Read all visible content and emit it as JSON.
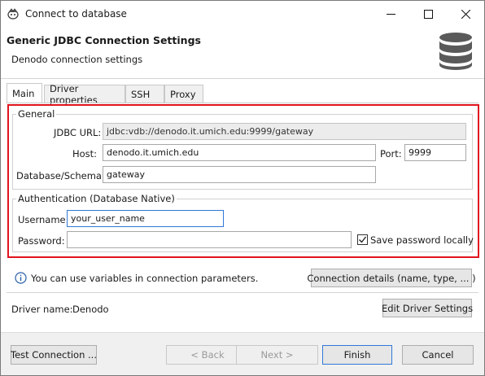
{
  "window": {
    "title": "Connect to database",
    "minimize_glyph": "—",
    "maximize_glyph": "☐",
    "close_glyph": "✕"
  },
  "header": {
    "title": "Generic JDBC Connection Settings",
    "subtitle": "Denodo connection settings",
    "icon": "database-icon"
  },
  "tabs": [
    {
      "label": "Main",
      "active": true
    },
    {
      "label": "Driver properties",
      "active": false
    },
    {
      "label": "SSH",
      "active": false
    },
    {
      "label": "Proxy",
      "active": false
    }
  ],
  "general": {
    "group_label": "General",
    "jdbc_url_label": "JDBC URL:",
    "jdbc_url_value": "jdbc:vdb://denodo.it.umich.edu:9999/gateway",
    "host_label": "Host:",
    "host_value": "denodo.it.umich.edu",
    "port_label": "Port:",
    "port_value": "9999",
    "database_label": "Database/Schema:",
    "database_value": "gateway"
  },
  "auth": {
    "group_label": "Authentication (Database Native)",
    "username_label": "Username:",
    "username_value": "your_user_name",
    "password_label": "Password:",
    "password_value": "",
    "save_password_label": "Save password locally",
    "save_password_checked": true
  },
  "info": {
    "icon": "info-icon",
    "text": "You can use variables in connection parameters.",
    "details_button": "Connection details (name, type, ... )"
  },
  "driver": {
    "label": "Driver name:",
    "value": "Denodo",
    "edit_button": "Edit Driver Settings"
  },
  "footer": {
    "test_connection": "Test Connection ...",
    "back": "< Back",
    "next": "Next >",
    "finish": "Finish",
    "cancel": "Cancel"
  },
  "colors": {
    "highlight": "#e0141e",
    "focus": "#2f78d7"
  }
}
